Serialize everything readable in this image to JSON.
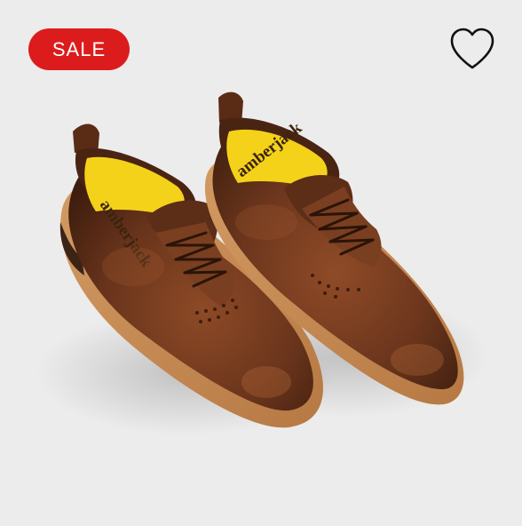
{
  "badge": {
    "label": "SALE",
    "color": "#dc1c1c"
  },
  "wishlist": {
    "icon": "heart-outline-icon"
  },
  "product_image": {
    "subject": "brown leather derby shoes pair",
    "insole_brand": "amberjack",
    "leather_color": "#6b351c",
    "insole_color": "#f4d21a",
    "sole_color": "#c98a52"
  },
  "colors": {
    "background": "#ececec"
  }
}
